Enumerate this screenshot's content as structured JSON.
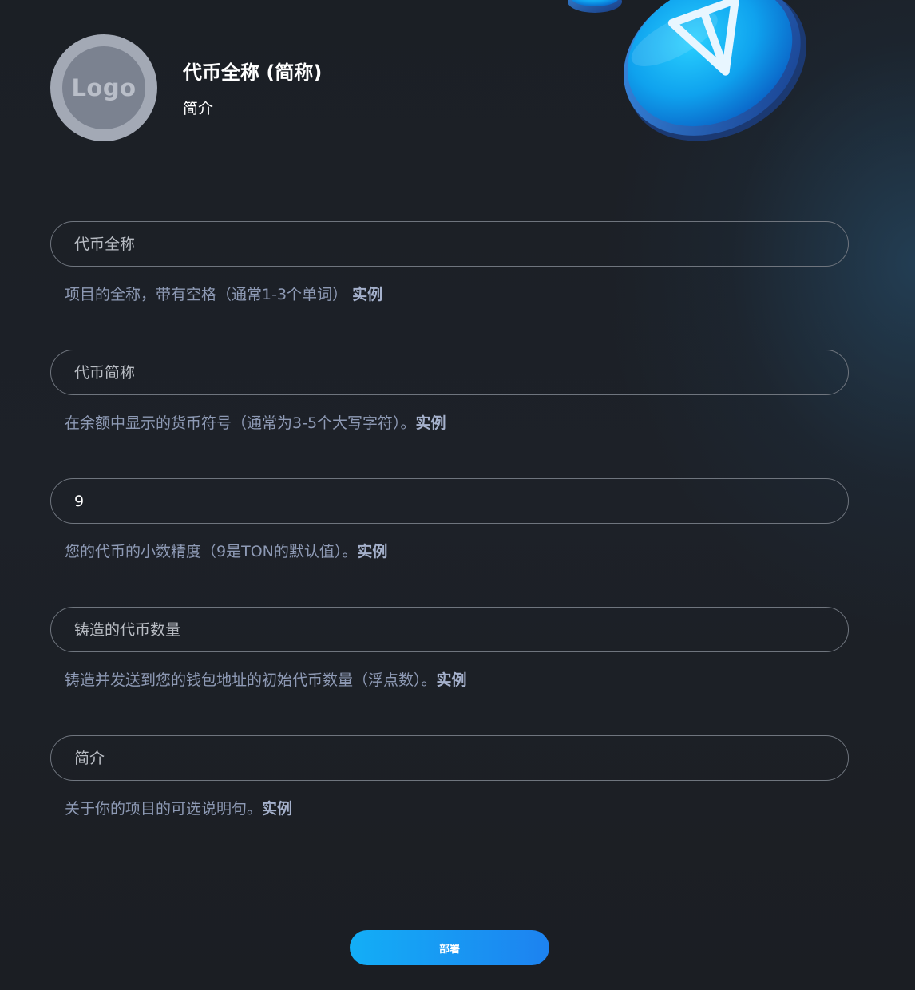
{
  "header": {
    "logo_text": "Logo",
    "title": "代币全称 (简称)",
    "description": "简介"
  },
  "form": {
    "fields": [
      {
        "placeholder": "代币全称",
        "value": "",
        "hint": "项目的全称，带有空格（通常1-3个单词）",
        "example_label": "实例"
      },
      {
        "placeholder": "代币简称",
        "value": "",
        "hint": "在余额中显示的货币符号（通常为3-5个大写字符）。",
        "example_label": "实例"
      },
      {
        "placeholder": "",
        "value": "9",
        "hint": "您的代币的小数精度（9是TON的默认值）。",
        "example_label": "实例"
      },
      {
        "placeholder": "铸造的代币数量",
        "value": "",
        "hint": "铸造并发送到您的钱包地址的初始代币数量（浮点数）。",
        "example_label": "实例"
      },
      {
        "placeholder": "简介",
        "value": "",
        "hint": "关于你的项目的可选说明句。",
        "example_label": "实例"
      }
    ]
  },
  "deploy": {
    "label": "部署"
  },
  "decoration": {
    "coin_icon": "ton-coin-icon"
  },
  "colors": {
    "accent_start": "#13aef6",
    "accent_end": "#1d82f0",
    "hint_text": "#8e9ab5",
    "input_border": "#6f757e"
  }
}
